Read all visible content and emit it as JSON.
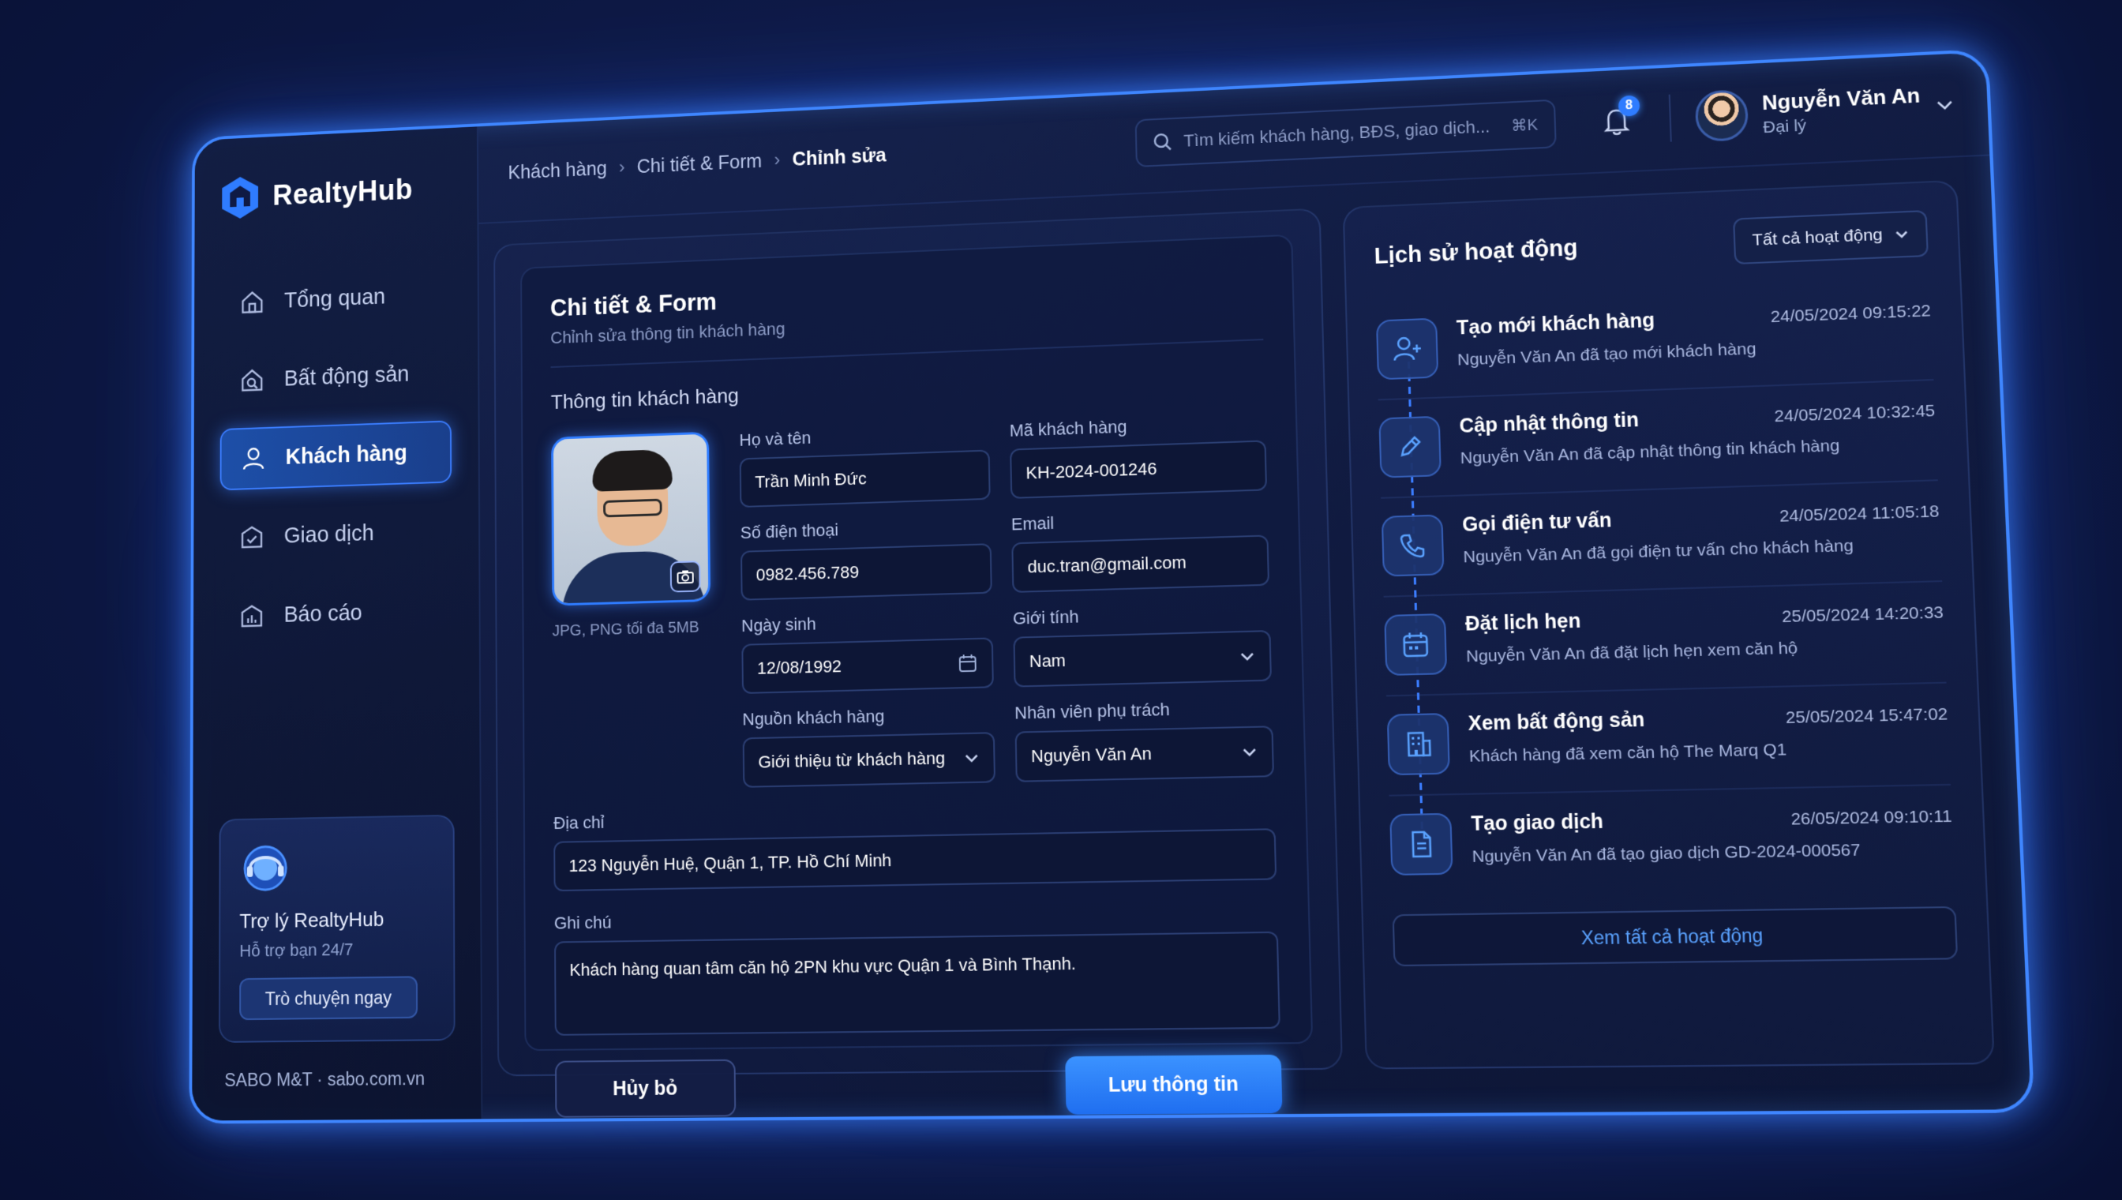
{
  "brand": {
    "name": "RealtyHub",
    "accent": "#3b7dff"
  },
  "sidebar": {
    "items": [
      {
        "label": "Tổng quan",
        "icon": "home-icon",
        "active": false
      },
      {
        "label": "Bất động sản",
        "icon": "house-search-icon",
        "active": false
      },
      {
        "label": "Khách hàng",
        "icon": "user-icon",
        "active": true
      },
      {
        "label": "Giao dịch",
        "icon": "transaction-icon",
        "active": false
      },
      {
        "label": "Báo cáo",
        "icon": "report-icon",
        "active": false
      }
    ],
    "assistant": {
      "title": "Trợ lý RealtyHub",
      "subtitle": "Hỗ trợ bạn 24/7",
      "button": "Trò chuyện ngay"
    },
    "footer": "SABO M&T · sabo.com.vn"
  },
  "header": {
    "breadcrumbs": [
      "Khách hàng",
      "Chi tiết & Form",
      "Chỉnh sửa"
    ],
    "search_placeholder": "Tìm kiếm khách hàng, BĐS, giao dịch...",
    "search_shortcut": "⌘K",
    "notifications_count": "8",
    "user": {
      "name": "Nguyễn Văn An",
      "role": "Đại lý"
    }
  },
  "form": {
    "title": "Chi tiết & Form",
    "subtitle": "Chỉnh sửa thông tin khách hàng",
    "section_title": "Thông tin khách hàng",
    "photo_hint": "JPG, PNG tối đa 5MB",
    "fields": {
      "full_name": {
        "label": "Họ và tên",
        "value": "Trần Minh Đức"
      },
      "customer_code": {
        "label": "Mã khách hàng",
        "value": "KH-2024-001246"
      },
      "phone": {
        "label": "Số điện thoại",
        "value": "0982.456.789"
      },
      "email": {
        "label": "Email",
        "value": "duc.tran@gmail.com"
      },
      "birthday": {
        "label": "Ngày sinh",
        "value": "12/08/1992"
      },
      "gender": {
        "label": "Giới tính",
        "value": "Nam"
      },
      "source": {
        "label": "Nguồn khách hàng",
        "value": "Giới thiệu từ khách hàng"
      },
      "staff": {
        "label": "Nhân viên phụ trách",
        "value": "Nguyễn Văn An"
      },
      "address": {
        "label": "Địa chỉ",
        "value": "123 Nguyễn Huệ, Quận 1, TP. Hồ Chí Minh"
      },
      "note": {
        "label": "Ghi chú",
        "value": "Khách hàng quan tâm căn hộ 2PN khu vực Quận 1 và Bình Thạnh."
      }
    },
    "cancel_label": "Hủy bỏ",
    "save_label": "Lưu thông tin"
  },
  "activity": {
    "title": "Lịch sử hoạt động",
    "filter": "Tất cả hoạt động",
    "items": [
      {
        "title": "Tạo mới khách hàng",
        "time": "24/05/2024 09:15:22",
        "desc": "Nguyễn Văn An đã tạo mới khách hàng",
        "icon": "user-add-icon"
      },
      {
        "title": "Cập nhật thông tin",
        "time": "24/05/2024 10:32:45",
        "desc": "Nguyễn Văn An đã cập nhật thông tin khách hàng",
        "icon": "edit-icon"
      },
      {
        "title": "Gọi điện tư vấn",
        "time": "24/05/2024 11:05:18",
        "desc": "Nguyễn Văn An đã gọi điện tư vấn cho khách hàng",
        "icon": "phone-icon"
      },
      {
        "title": "Đặt lịch hẹn",
        "time": "25/05/2024 14:20:33",
        "desc": "Nguyễn Văn An đã đặt lịch hẹn xem căn hộ",
        "icon": "calendar-icon"
      },
      {
        "title": "Xem bất động sản",
        "time": "25/05/2024 15:47:02",
        "desc": "Khách hàng đã xem căn hộ The Marq Q1",
        "icon": "building-icon"
      },
      {
        "title": "Tạo giao dịch",
        "time": "26/05/2024 09:10:11",
        "desc": "Nguyễn Văn An đã tạo giao dịch GD-2024-000567",
        "icon": "document-icon"
      }
    ],
    "view_all": "Xem tất cả hoạt động"
  }
}
